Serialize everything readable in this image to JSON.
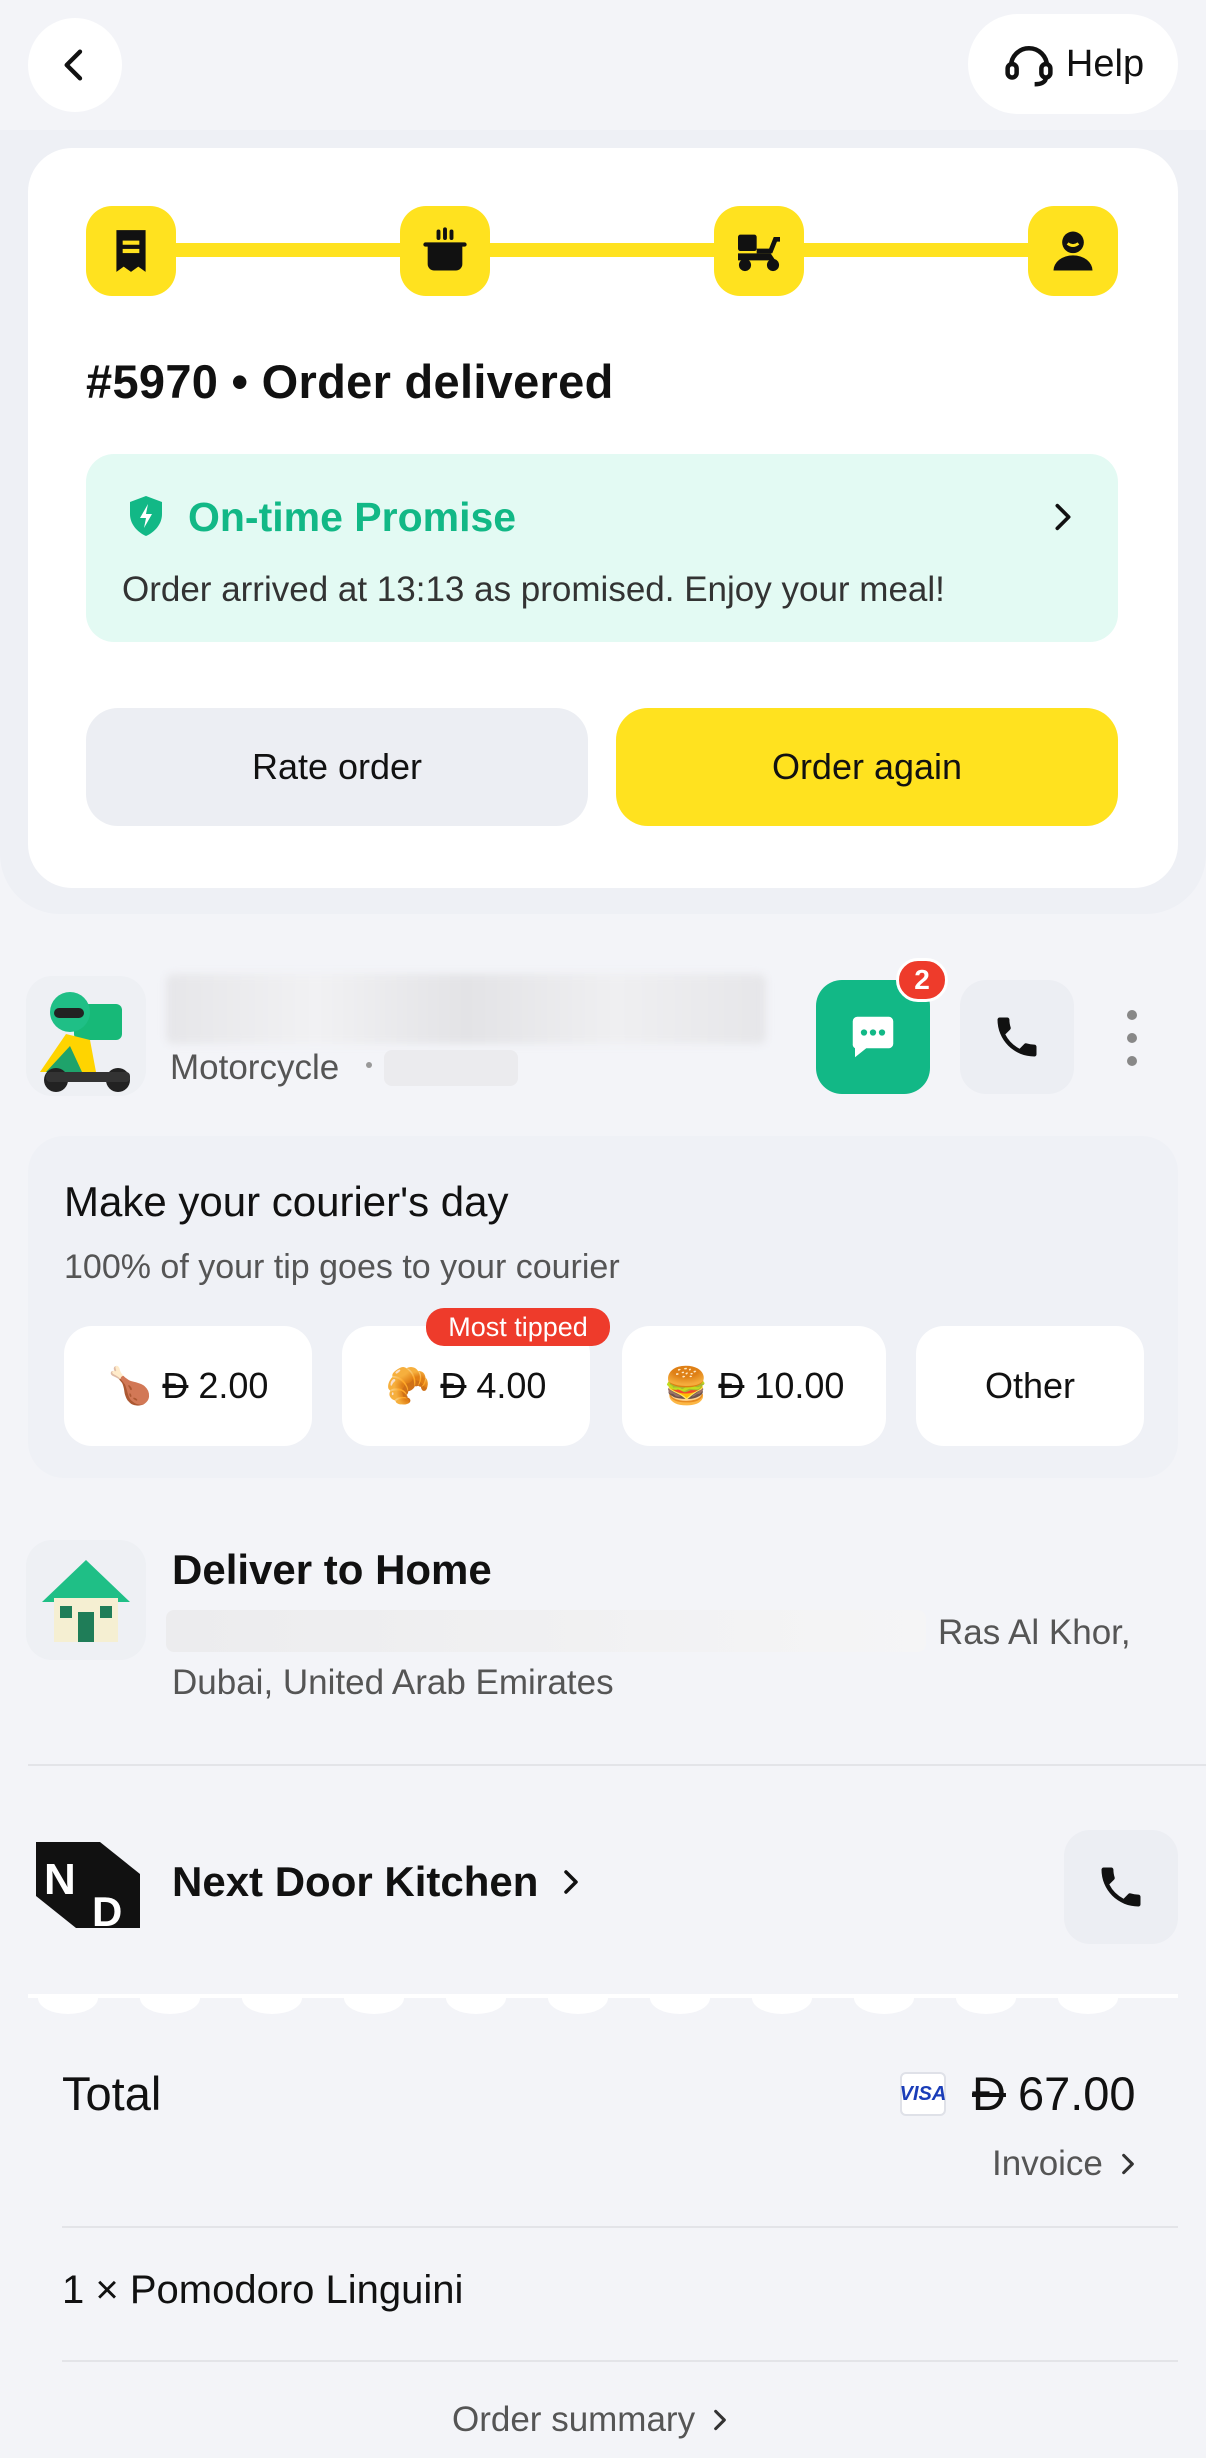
{
  "topbar": {
    "help_label": "Help"
  },
  "order": {
    "title": "#5970 • Order delivered",
    "promise_title": "On-time Promise",
    "promise_text": "Order arrived at 13:13 as promised. Enjoy your meal!",
    "rate_label": "Rate order",
    "again_label": "Order again",
    "steps": [
      "receipt-icon",
      "cooking-pot-icon",
      "scooter-icon",
      "customer-icon"
    ]
  },
  "courier": {
    "vehicle": "Motorcycle",
    "unread_count": "2"
  },
  "tip": {
    "title": "Make your courier's day",
    "subtitle": "100% of your tip goes to your courier",
    "options": [
      {
        "emoji": "🍗",
        "currency": "Đ",
        "amount": "2.00"
      },
      {
        "emoji": "🥐",
        "currency": "Đ",
        "amount": "4.00",
        "flag": "Most tipped"
      },
      {
        "emoji": "🍔",
        "currency": "Đ",
        "amount": "10.00"
      }
    ],
    "other_label": "Other"
  },
  "delivery": {
    "title": "Deliver to Home",
    "address_line1_tail": "Ras Al Khor,",
    "address_line2": "Dubai, United Arab Emirates"
  },
  "restaurant": {
    "name": "Next Door Kitchen",
    "logo_letters": [
      "N",
      "D"
    ]
  },
  "summary": {
    "total_label": "Total",
    "card_brand": "VISA",
    "currency": "Đ",
    "total_value": "67.00",
    "invoice_label": "Invoice",
    "item": "1 × Pomodoro Linguini",
    "summary_label": "Order summary"
  },
  "colors": {
    "accent_yellow": "#ffe21f",
    "accent_green": "#12b886",
    "badge_red": "#ee3b2b"
  }
}
